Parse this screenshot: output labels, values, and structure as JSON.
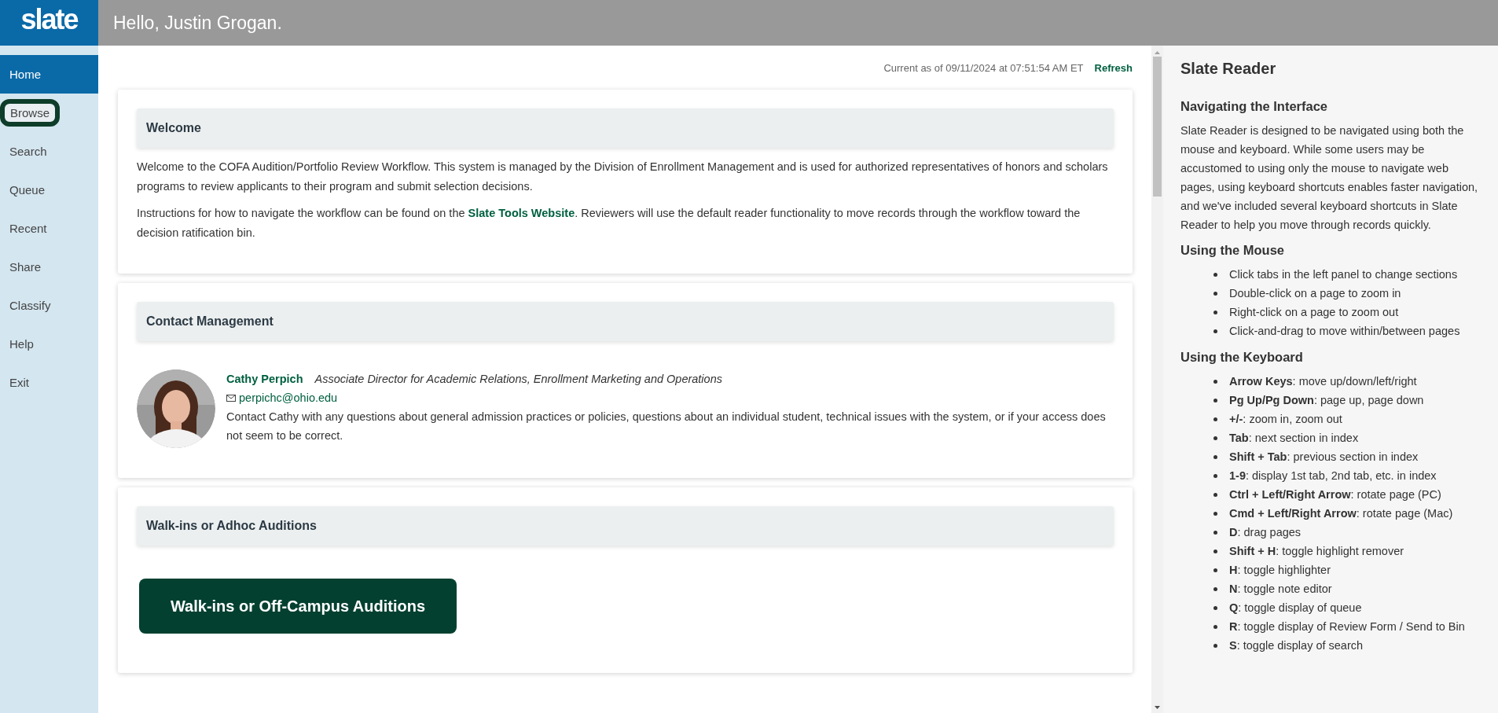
{
  "logo": "slate",
  "header": {
    "greeting": "Hello, Justin Grogan."
  },
  "sidebar": {
    "items": [
      {
        "label": "Home",
        "selected": true,
        "focused": false
      },
      {
        "label": "Browse",
        "selected": false,
        "focused": true
      },
      {
        "label": "Search",
        "selected": false,
        "focused": false
      },
      {
        "label": "Queue",
        "selected": false,
        "focused": false
      },
      {
        "label": "Recent",
        "selected": false,
        "focused": false
      },
      {
        "label": "Share",
        "selected": false,
        "focused": false
      },
      {
        "label": "Classify",
        "selected": false,
        "focused": false
      },
      {
        "label": "Help",
        "selected": false,
        "focused": false
      },
      {
        "label": "Exit",
        "selected": false,
        "focused": false
      }
    ]
  },
  "status": {
    "timestamp": "Current as of 09/11/2024 at 07:51:54 AM ET",
    "refresh": "Refresh"
  },
  "cards": [
    {
      "kind": "text",
      "title": "Welcome",
      "paragraphs": [
        {
          "text": "Welcome to the COFA Audition/Portfolio Review Workflow. This system is managed by the Division of Enrollment Management and is used for authorized representatives of honors and scholars programs to review applicants to their program and submit selection decisions."
        },
        {
          "text": "Instructions for how to navigate the workflow can be found on the ",
          "link": "Slate Tools Website",
          "after": ". Reviewers will use the default reader functionality to move records through the workflow toward the decision ratification bin."
        }
      ]
    },
    {
      "kind": "contact",
      "title": "Contact Management",
      "contact": {
        "name": "Cathy Perpich",
        "role": "Associate Director for Academic Relations, Enrollment Marketing and Operations",
        "email": "perpichc@ohio.edu",
        "note": "Contact Cathy with any questions about general admission practices or policies, questions about an individual student, technical issues with the system, or if your access does not seem to be correct."
      }
    },
    {
      "kind": "action",
      "title": "Walk-ins or Adhoc Auditions",
      "button": "Walk-ins or Off-Campus Auditions"
    }
  ],
  "reader": {
    "title": "Slate Reader",
    "sections": [
      {
        "heading": "Navigating the Interface",
        "paragraph": "Slate Reader is designed to be navigated using both the mouse and keyboard. While some users may be accustomed to using only the mouse to navigate web pages, using keyboard shortcuts enables faster navigation, and we've included several keyboard shortcuts in Slate Reader to help you move through records quickly."
      },
      {
        "heading": "Using the Mouse",
        "items": [
          "Click tabs in the left panel to change sections",
          "Double-click on a page to zoom in",
          "Right-click on a page to zoom out",
          "Click-and-drag to move within/between pages"
        ]
      },
      {
        "heading": "Using the Keyboard",
        "items": [
          "**Arrow Keys**: move up/down/left/right",
          "**Pg Up/Pg Down**: page up, page down",
          "**+/-**: zoom in, zoom out",
          "**Tab**: next section in index",
          "**Shift + Tab**: previous section in index",
          "**1-9**: display 1st tab, 2nd tab, etc. in index",
          "**Ctrl + Left/Right Arrow**: rotate page (PC)",
          "**Cmd + Left/Right Arrow**: rotate page (Mac)",
          "**D**: drag pages",
          "**Shift + H**: toggle highlight remover",
          "**H**: toggle highlighter",
          "**N**: toggle note editor",
          "**Q**: toggle display of queue",
          "**R**: toggle display of Review Form / Send to Bin",
          "**S**: toggle display of search"
        ]
      }
    ]
  }
}
